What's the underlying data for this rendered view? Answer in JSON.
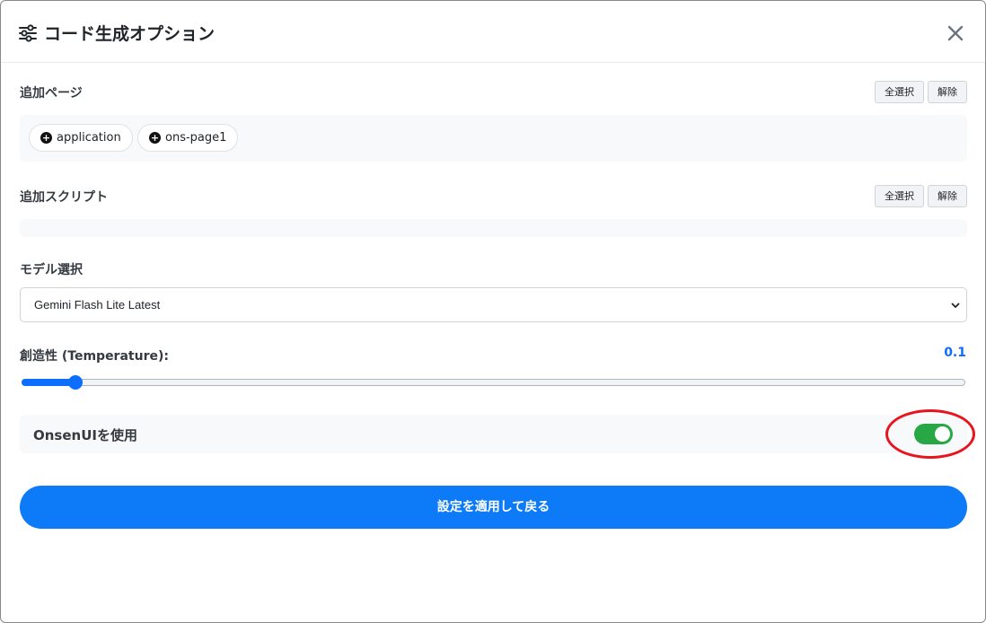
{
  "header": {
    "title": "コード生成オプション",
    "icon": "sliders-icon",
    "close_icon": "close-icon"
  },
  "pages_section": {
    "label": "追加ページ",
    "select_all_label": "全選択",
    "clear_label": "解除",
    "items": [
      {
        "label": "application",
        "icon": "plus-circle-icon"
      },
      {
        "label": "ons-page1",
        "icon": "plus-circle-icon"
      }
    ]
  },
  "scripts_section": {
    "label": "追加スクリプト",
    "select_all_label": "全選択",
    "clear_label": "解除",
    "items": []
  },
  "model_section": {
    "label": "モデル選択",
    "selected": "Gemini Flash Lite Latest"
  },
  "temperature": {
    "label": "創造性 (Temperature):",
    "value": "0.1",
    "level": 0.05
  },
  "onsen": {
    "label": "OnsenUIを使用",
    "enabled": true
  },
  "apply_button_label": "設定を適用して戻る",
  "colors": {
    "accent": "#0d6efd",
    "toggle_on": "#28a745",
    "annotation": "#e8141e"
  }
}
